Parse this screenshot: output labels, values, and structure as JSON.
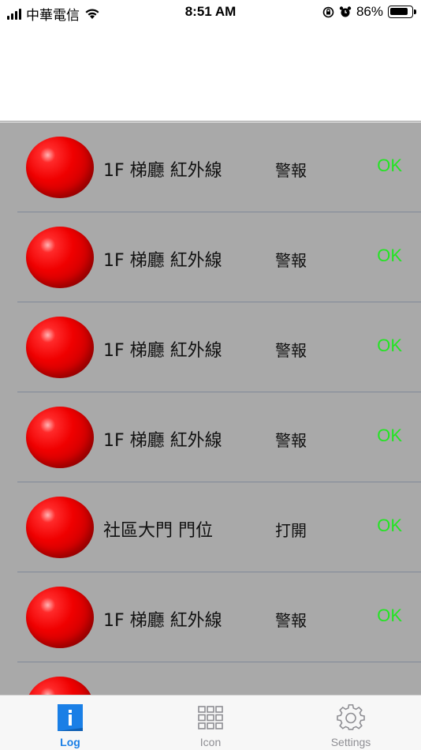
{
  "status_bar": {
    "carrier": "中華電信",
    "time": "8:51 AM",
    "battery": "86%",
    "battery_level": 0.86
  },
  "log_items": [
    {
      "name": "1F 梯廳 紅外線",
      "status": "警報",
      "result": "OK"
    },
    {
      "name": "1F 梯廳 紅外線",
      "status": "警報",
      "result": "OK"
    },
    {
      "name": "1F 梯廳 紅外線",
      "status": "警報",
      "result": "OK"
    },
    {
      "name": "1F 梯廳 紅外線",
      "status": "警報",
      "result": "OK"
    },
    {
      "name": "社區大門 門位",
      "status": "打開",
      "result": "OK"
    },
    {
      "name": "1F 梯廳 紅外線",
      "status": "警報",
      "result": "OK"
    },
    {
      "name": "",
      "status": "",
      "result": ""
    }
  ],
  "tabs": [
    {
      "label": "Log",
      "icon": "log-icon",
      "active": true
    },
    {
      "label": "Icon",
      "icon": "grid-icon",
      "active": false
    },
    {
      "label": "Settings",
      "icon": "gear-icon",
      "active": false
    }
  ],
  "colors": {
    "list_background": "#a9a9a9",
    "alarm_red": "#f00000",
    "ok_green": "#22e522",
    "tab_active": "#1a7fe6",
    "tab_inactive": "#8e8e93"
  }
}
